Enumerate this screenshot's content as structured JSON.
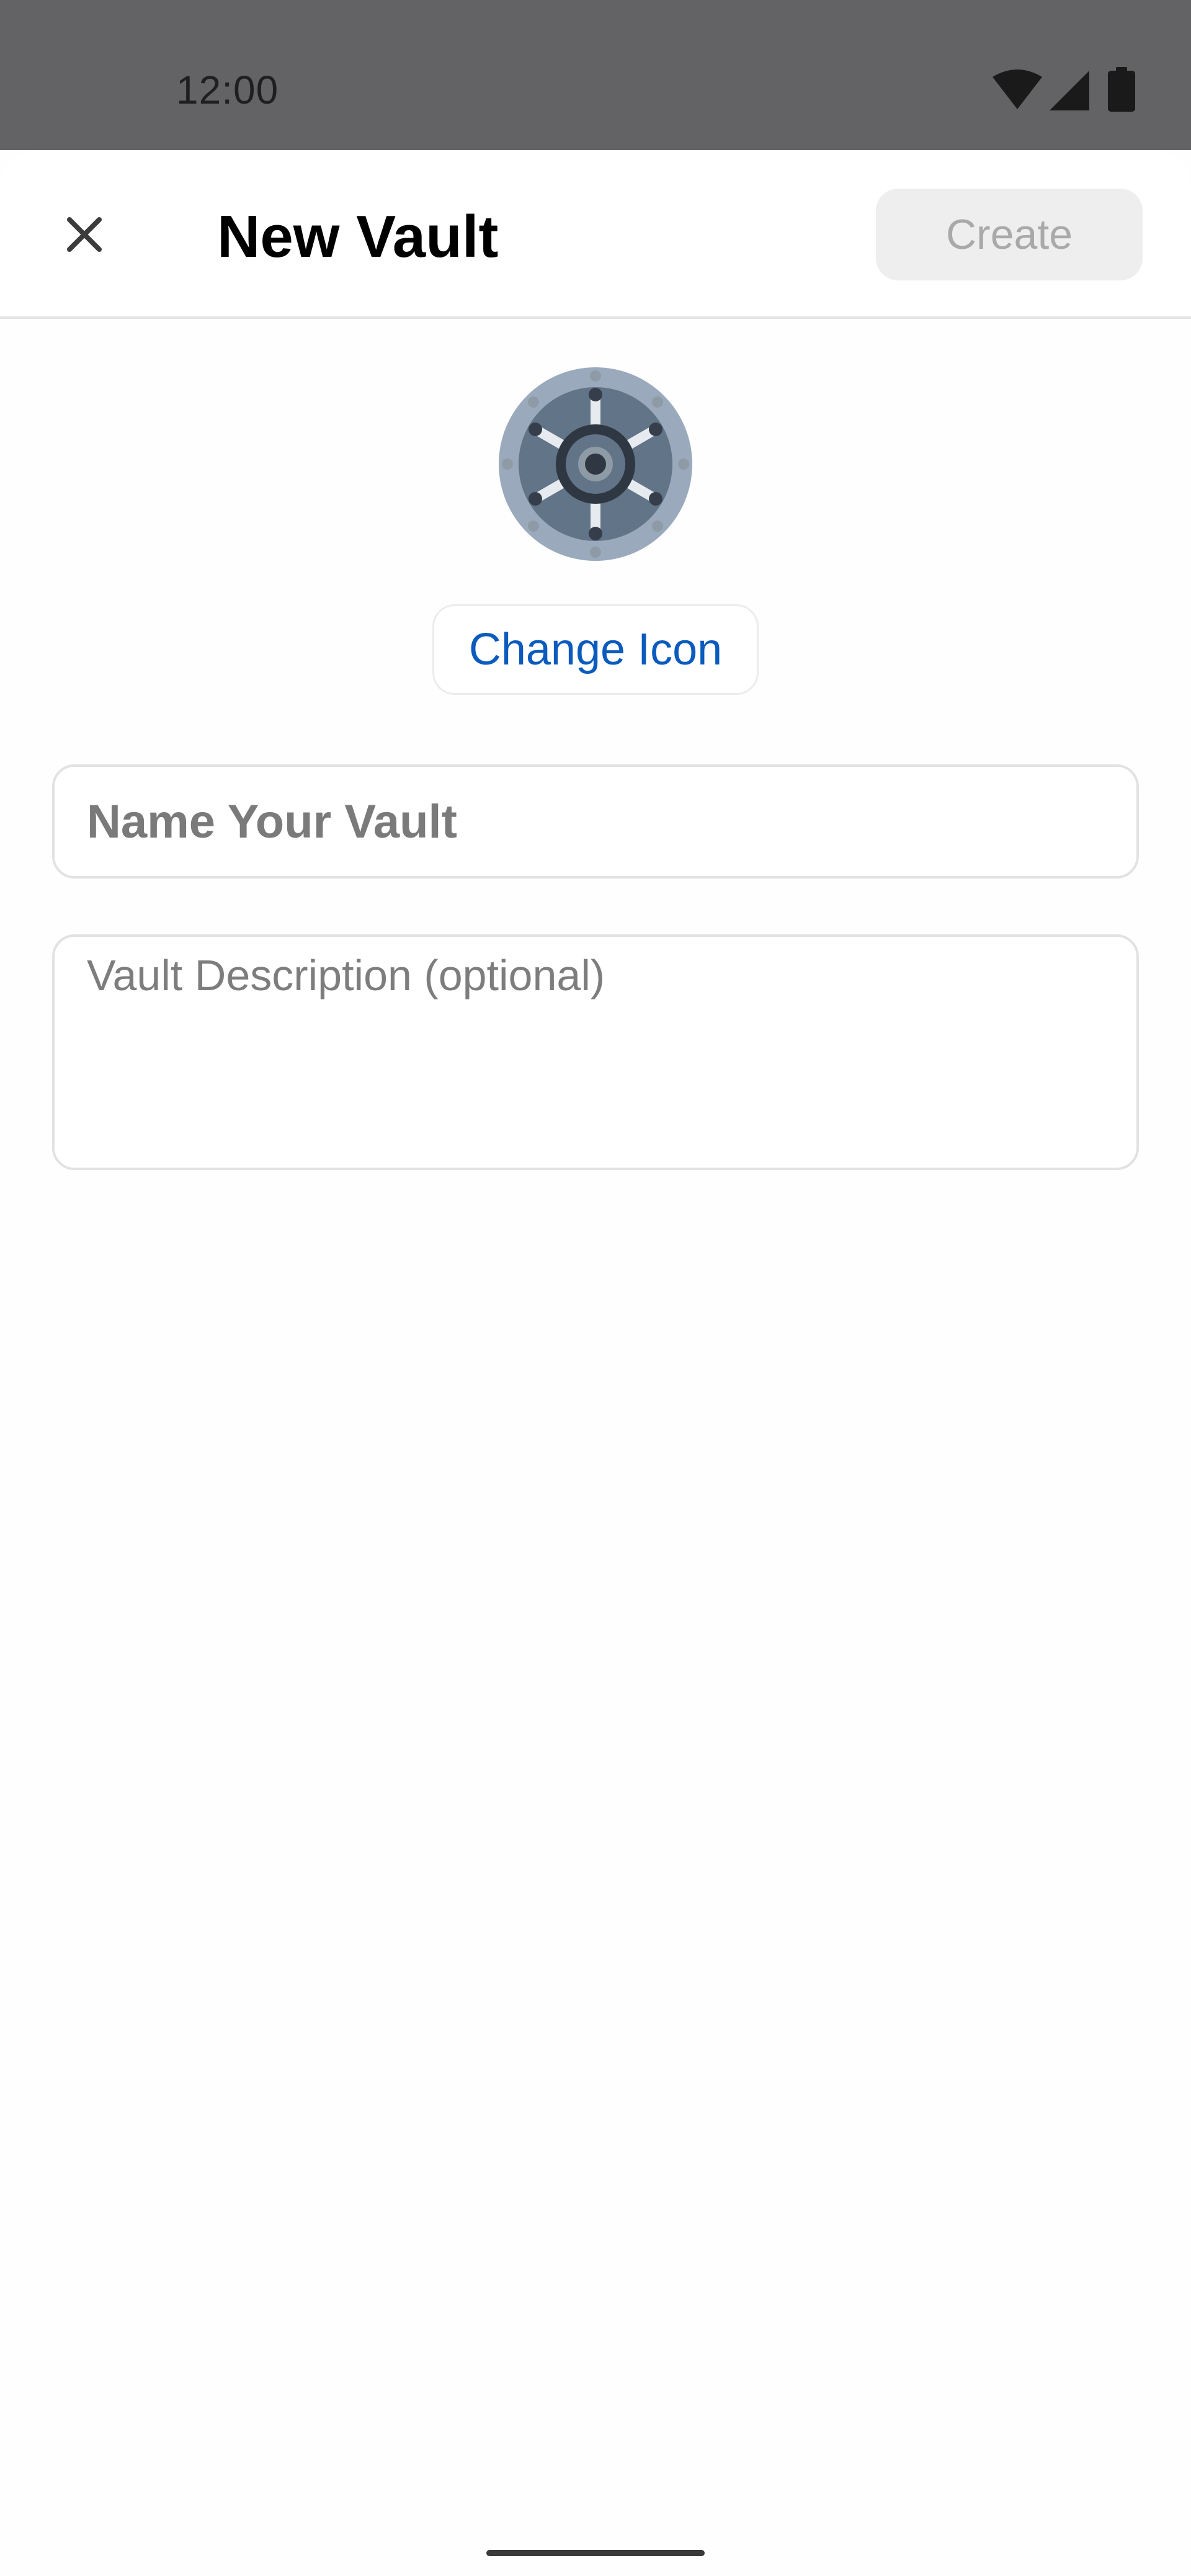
{
  "status_bar": {
    "time": "12:00",
    "icons": [
      "wifi-icon",
      "signal-icon",
      "battery-icon"
    ]
  },
  "header": {
    "close_icon": "close-icon",
    "title": "New Vault",
    "create_label": "Create"
  },
  "vault": {
    "icon": "vault-safe-icon",
    "change_icon_label": "Change Icon"
  },
  "form": {
    "name_placeholder": "Name Your Vault",
    "name_value": "",
    "description_placeholder": "Vault Description (optional)",
    "description_value": ""
  },
  "colors": {
    "accent": "#0a5bbd",
    "status_bar_bg": "#636365",
    "disabled_button_bg": "#eeeeee",
    "disabled_button_text": "#a9a9a9"
  }
}
